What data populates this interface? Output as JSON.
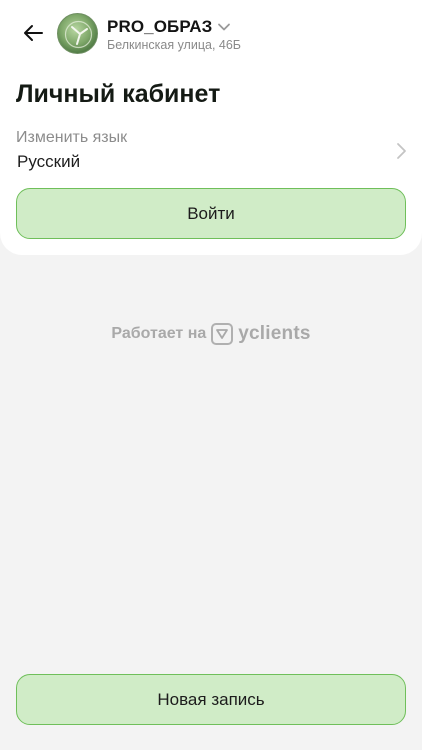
{
  "header": {
    "company_name": "PRO_ОБРАЗ",
    "address": "Белкинская улица, 46Б",
    "back_icon": "arrow-left-icon",
    "dropdown_icon": "chevron-down-icon"
  },
  "page": {
    "title": "Личный кабинет"
  },
  "language": {
    "label": "Изменить язык",
    "value": "Русский",
    "icon": "chevron-right-icon"
  },
  "buttons": {
    "login_label": "Войти",
    "new_booking_label": "Новая запись"
  },
  "footer": {
    "powered_text": "Работает на",
    "brand": "yclients"
  },
  "colors": {
    "accent_fill": "#d0ecc7",
    "accent_border": "#6fbf5a",
    "background": "#f3f3f3"
  }
}
